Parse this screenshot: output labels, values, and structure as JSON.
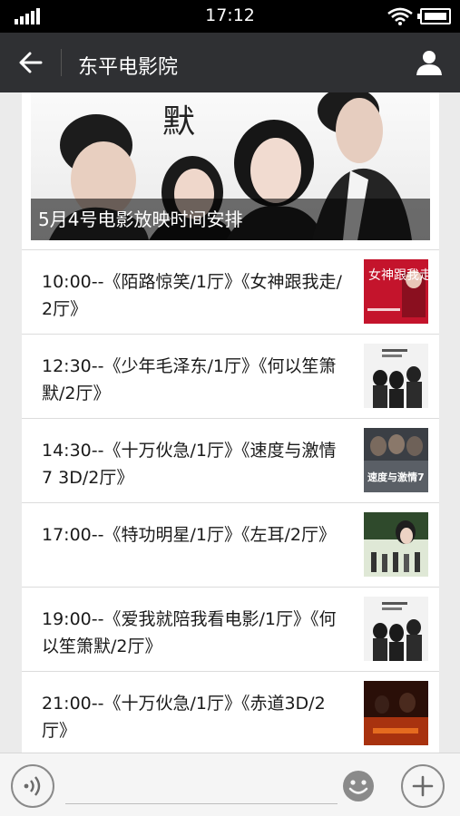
{
  "status_bar": {
    "time": "17:12"
  },
  "nav": {
    "title": "东平电影院"
  },
  "banner": {
    "caption": "5月4号电影放映时间安排"
  },
  "schedule": [
    {
      "text": "10:00--《陌路惊笑/1厅》《女神跟我走/2厅》",
      "poster_text": "女神跟我走"
    },
    {
      "text": "12:30--《少年毛泽东/1厅》《何以笙箫默/2厅》",
      "poster_text": ""
    },
    {
      "text": "14:30--《十万伙急/1厅》《速度与激情7 3D/2厅》",
      "poster_text": "速度与激情7"
    },
    {
      "text": "17:00--《特功明星/1厅》《左耳/2厅》",
      "poster_text": ""
    },
    {
      "text": "19:00--《爱我就陪我看电影/1厅》《何以笙箫默/2厅》",
      "poster_text": ""
    },
    {
      "text": "21:00--《十万伙急/1厅》《赤道3D/2厅》",
      "poster_text": ""
    }
  ],
  "bottom_bar": {
    "input_value": ""
  }
}
